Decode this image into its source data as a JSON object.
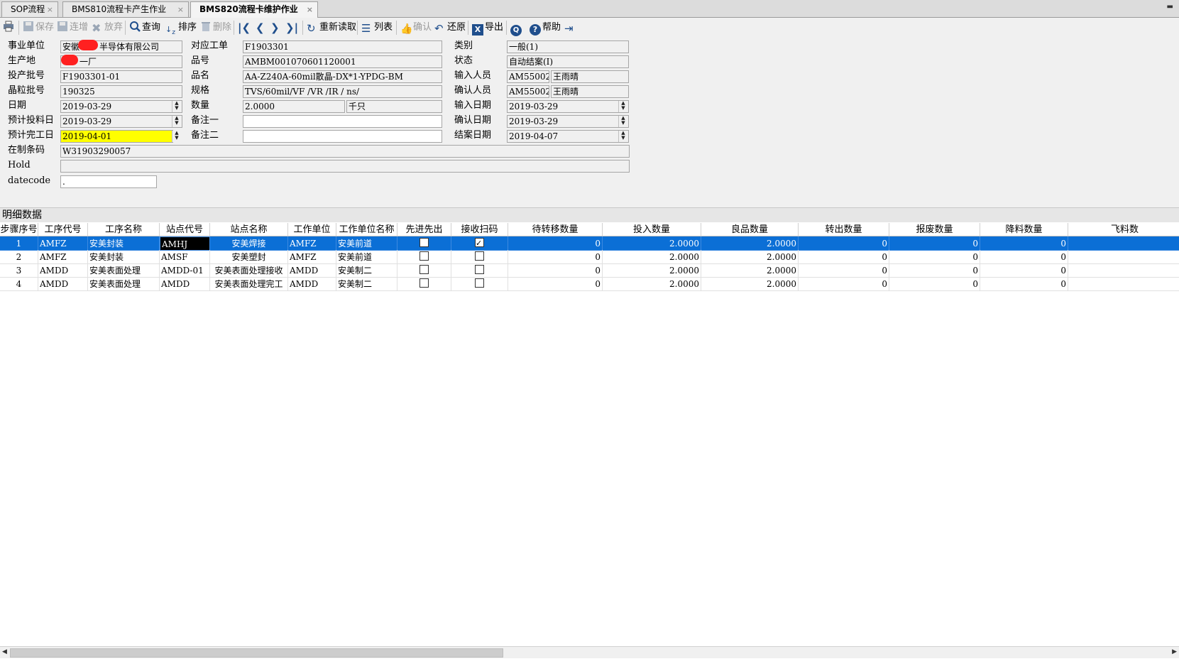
{
  "tabs": [
    {
      "label": "SOP流程",
      "close": "×"
    },
    {
      "label": "BMS810流程卡产生作业",
      "close": "×"
    },
    {
      "label": "BMS820流程卡维护作业",
      "close": "×"
    }
  ],
  "toolbar": {
    "save": "保存",
    "add": "连增",
    "discard": "放弃",
    "query": "查询",
    "sort": "排序",
    "delete": "删除",
    "reload": "重新读取",
    "list": "列表",
    "confirm": "确认",
    "restore": "还原",
    "export": "导出",
    "help": "帮助"
  },
  "form": {
    "biz_unit_label": "事业单位",
    "biz_unit_value_prefix": "安徽",
    "biz_unit_value_suffix": "半导体有限公司",
    "site_label": "生产地",
    "site_value": "一厂",
    "lot_label": "投产批号",
    "lot_value": "F1903301-01",
    "wafer_lot_label": "晶粒批号",
    "wafer_lot_value": "190325",
    "date_label": "日期",
    "date_value": "2019-03-29",
    "plan_input_label": "预计投料日",
    "plan_input_value": "2019-03-29",
    "plan_finish_label": "预计完工日",
    "plan_finish_value": "2019-04-01",
    "wip_code_label": "在制条码",
    "wip_code_value": "W31903290057",
    "hold_label": "Hold",
    "hold_value": "",
    "datecode_label": "datecode",
    "datecode_value": ".",
    "work_order_label": "对应工单",
    "work_order_value": "F1903301",
    "part_no_label": "品号",
    "part_no_value": "AMBM001070601120001",
    "part_name_label": "品名",
    "part_name_value": "AA-Z240A-60mil散晶-DX*1-YPDG-BM",
    "spec_label": "规格",
    "spec_value": "TVS/60mil/VF /VR /IR / ns/",
    "qty_label": "数量",
    "qty_value": "2.0000",
    "qty_unit": "千只",
    "remark1_label": "备注一",
    "remark1_value": "",
    "remark2_label": "备注二",
    "remark2_value": "",
    "category_label": "类别",
    "category_value": "一般(1)",
    "status_label": "状态",
    "status_value": "自动结案(I)",
    "input_user_label": "输入人员",
    "input_user_id": "AM55002",
    "input_user_name": "王雨晴",
    "confirm_user_label": "确认人员",
    "confirm_user_id": "AM55002",
    "confirm_user_name": "王雨晴",
    "input_date_label": "输入日期",
    "input_date_value": "2019-03-29",
    "confirm_date_label": "确认日期",
    "confirm_date_value": "2019-03-29",
    "close_date_label": "结案日期",
    "close_date_value": "2019-04-07"
  },
  "detail": {
    "title": "明细数据",
    "columns": [
      "步骤序号",
      "工序代号",
      "工序名称",
      "站点代号",
      "站点名称",
      "工作单位",
      "工作单位名称",
      "先进先出",
      "接收扫码",
      "待转移数量",
      "投入数量",
      "良品数量",
      "转出数量",
      "报废数量",
      "降料数量",
      "飞料数"
    ],
    "rows": [
      {
        "step": "1",
        "proc_code": "AMFZ",
        "proc_name": "安美封装",
        "station_code": "AMHJ",
        "station_name": "安美焊接",
        "unit": "AMFZ",
        "unit_name": "安美前道",
        "fifo": false,
        "scan": true,
        "pending": "0",
        "input": "2.0000",
        "good": "2.0000",
        "out": "0",
        "scrap": "0",
        "down": "0"
      },
      {
        "step": "2",
        "proc_code": "AMFZ",
        "proc_name": "安美封装",
        "station_code": "AMSF",
        "station_name": "安美塑封",
        "unit": "AMFZ",
        "unit_name": "安美前道",
        "fifo": false,
        "scan": false,
        "pending": "0",
        "input": "2.0000",
        "good": "2.0000",
        "out": "0",
        "scrap": "0",
        "down": "0"
      },
      {
        "step": "3",
        "proc_code": "AMDD",
        "proc_name": "安美表面处理",
        "station_code": "AMDD-01",
        "station_name": "安美表面处理接收",
        "unit": "AMDD",
        "unit_name": "安美制二",
        "fifo": false,
        "scan": false,
        "pending": "0",
        "input": "2.0000",
        "good": "2.0000",
        "out": "0",
        "scrap": "0",
        "down": "0"
      },
      {
        "step": "4",
        "proc_code": "AMDD",
        "proc_name": "安美表面处理",
        "station_code": "AMDD",
        "station_name": "安美表面处理完工",
        "unit": "AMDD",
        "unit_name": "安美制二",
        "fifo": false,
        "scan": false,
        "pending": "0",
        "input": "2.0000",
        "good": "2.0000",
        "out": "0",
        "scrap": "0",
        "down": "0"
      }
    ]
  },
  "colors": {
    "selected_row": "#0b6fd6",
    "highlight_field": "#ffff00",
    "redaction": "#ff2020"
  }
}
